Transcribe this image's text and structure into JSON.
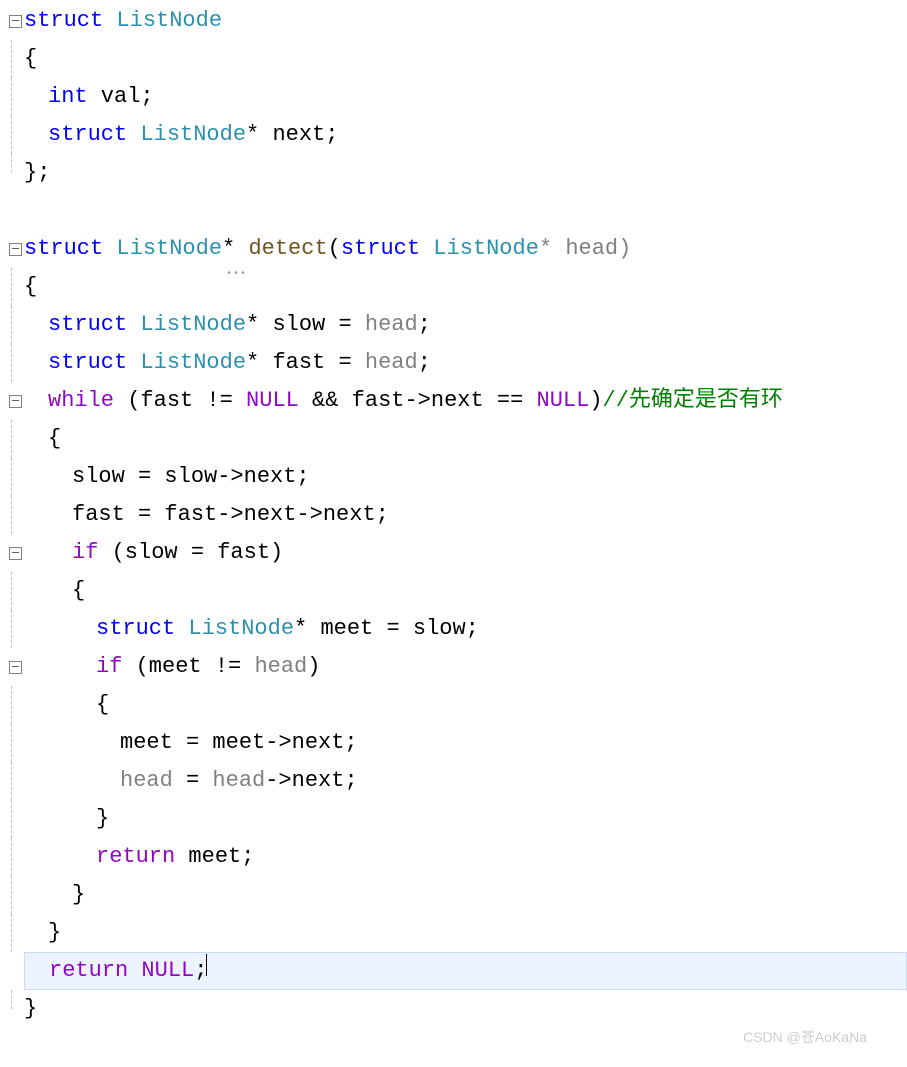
{
  "code": {
    "keywords": {
      "struct": "struct",
      "int": "int",
      "while": "while",
      "if": "if",
      "return": "return"
    },
    "types": {
      "ListNode": "ListNode"
    },
    "nulls": {
      "NULL": "NULL"
    },
    "lines": {
      "l1_struct": "struct",
      "l1_type": " ListNode",
      "l2": "{",
      "l3_kw": "int",
      "l3_ident": " val;",
      "l4_kw": "struct",
      "l4_type": " ListNode",
      "l4_rest": "* next;",
      "l5": "};",
      "l7_kw1": "struct",
      "l7_type1": " ListNode",
      "l7_star": "* ",
      "l7_func": "detect",
      "l7_paren": "(",
      "l7_kw2": "struct",
      "l7_type2": " ListNode",
      "l7_param": "* head)",
      "l8": "{",
      "l9_kw": "struct",
      "l9_type": " ListNode",
      "l9_rest": "* slow = ",
      "l9_param": "head",
      "l9_semi": ";",
      "l10_kw": "struct",
      "l10_type": " ListNode",
      "l10_rest": "* fast = ",
      "l10_param": "head",
      "l10_semi": ";",
      "l11_while": "while",
      "l11_p1": " (fast != ",
      "l11_null1": "NULL",
      "l11_mid": " && fast->next == ",
      "l11_null2": "NULL",
      "l11_p2": ")",
      "l11_comment": "//先确定是否有环",
      "l12": "{",
      "l13": "slow = slow->next;",
      "l14": "fast = fast->next->next;",
      "l15_if": "if",
      "l15_rest": " (slow = fast)",
      "l16": "{",
      "l17_kw": "struct",
      "l17_type": " ListNode",
      "l17_rest": "* meet = slow;",
      "l18_if": "if",
      "l18_p1": " (meet != ",
      "l18_param": "head",
      "l18_p2": ")",
      "l19": "{",
      "l20": "meet = meet->next;",
      "l21_param": "head",
      "l21_rest": " = ",
      "l21_param2": "head",
      "l21_rest2": "->next;",
      "l22": "}",
      "l23_ret": "return",
      "l23_rest": " meet;",
      "l24": "}",
      "l25": "}",
      "l26_ret": "return",
      "l26_sp": " ",
      "l26_null": "NULL",
      "l26_semi": ";",
      "l27": "}"
    }
  },
  "watermark": "CSDN @苍AoKaNa"
}
